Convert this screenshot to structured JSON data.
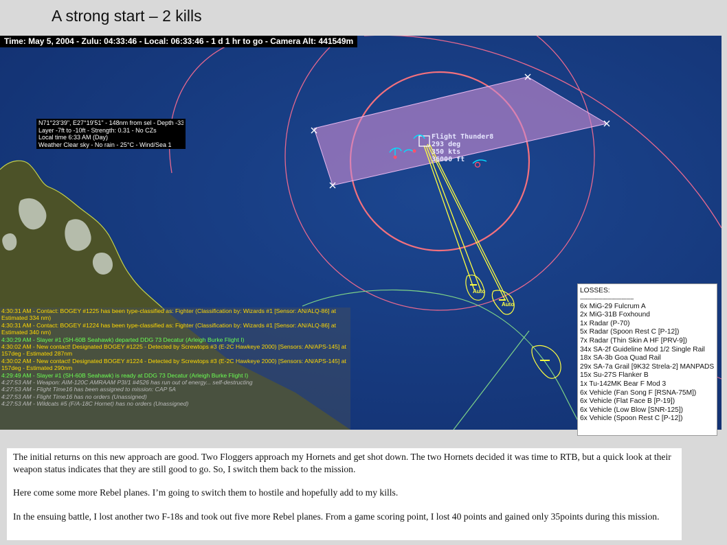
{
  "slide": {
    "title": "A strong start – 2 kills"
  },
  "map": {
    "time_bar": "Time: May 5, 2004 - Zulu: 04:33:46 - Local: 06:33:46 - 1 d 1 hr to go -  Camera Alt: 441549m",
    "info_box": [
      "N71°23'39\", E27°19'51\" - 148nm from sel - Depth -33ft",
      "Layer -7ft to -10ft - Strength: 0.31 - No CZs",
      "Local time 6:33 AM (Day)",
      "Weather Clear sky - No rain - 25°C - Wind/Sea 1"
    ],
    "unit_label": {
      "name": "Flight Thunder8",
      "heading": "293 deg",
      "speed": "350 kts",
      "altitude": "36000 ft"
    },
    "auto_labels": [
      "Auto",
      "Auto"
    ],
    "colors": {
      "ocean": "#14387a",
      "zone": "#e8698f",
      "track": "#ffff40",
      "patrol_area": "#c98ad1"
    }
  },
  "log": [
    {
      "text": "4:30:31 AM - Contact: BOGEY #1225 has been type-classified as: Fighter (Classification by: Wizards #1 [Sensor: AN/ALQ-86] at Estimated 334 nm)",
      "color": "yellow"
    },
    {
      "text": "4:30:31 AM - Contact: BOGEY #1224 has been type-classified as: Fighter (Classification by: Wizards #1 [Sensor: AN/ALQ-86] at Estimated 340 nm)",
      "color": "yellow"
    },
    {
      "text": "4:30:29 AM - Slayer #1 (SH-60B Seahawk) departed DDG 73 Decatur (Arleigh Burke Flight I)",
      "color": "green"
    },
    {
      "text": "4:30:02 AM - New contact! Designated BOGEY #1225 - Detected by Screwtops #3 (E-2C Hawkeye 2000)  [Sensors: AN/APS-145] at 157deg - Estimated 287nm",
      "color": "yellow"
    },
    {
      "text": "4:30:02 AM - New contact! Designated BOGEY #1224 - Detected by Screwtops #3 (E-2C Hawkeye 2000)  [Sensors: AN/APS-145] at 157deg - Estimated 290nm",
      "color": "yellow"
    },
    {
      "text": "4:29:49 AM - Slayer #1 (SH-60B Seahawk) is ready at DDG 73 Decatur (Arleigh Burke Flight I)",
      "color": "green"
    },
    {
      "text": "4:27:53 AM - Weapon: AIM-120C AMRAAM P3I/1 #4526 has run out of energy... self-destructing",
      "color": "gray"
    },
    {
      "text": "4:27:53 AM - Flight Time16 has been assigned to mission: CAP 5A",
      "color": "gray"
    },
    {
      "text": "4:27:53 AM - Flight Time16 has no orders (Unassigned)",
      "color": "gray"
    },
    {
      "text": "4:27:53 AM - Wildcats #5 (F/A-18C Hornet) has no orders (Unassigned)",
      "color": "gray"
    }
  ],
  "losses": {
    "title": "LOSSES:",
    "separator": "------------------------------------",
    "items": [
      "6x MiG-29 Fulcrum A",
      "2x MiG-31B Foxhound",
      "1x Radar (P-70)",
      "5x Radar (Spoon Rest C [P-12])",
      "7x Radar (Thin Skin A HF [PRV-9])",
      "34x SA-2f Guideline Mod 1/2 Single Rail",
      "18x SA-3b Goa Quad Rail",
      "29x SA-7a Grail [9K32 Strela-2] MANPADS",
      "15x Su-27S Flanker B",
      "1x Tu-142MK Bear F Mod 3",
      "6x Vehicle (Fan Song F [RSNA-75M])",
      "6x Vehicle (Flat Face B [P-19])",
      "6x Vehicle (Low Blow [SNR-125])",
      "6x Vehicle (Spoon Rest C [P-12])"
    ]
  },
  "narrative": [
    "The initial returns on this new approach are good.  Two Floggers approach my Hornets and get shot down.  The two Hornets decided it was time to RTB, but a quick look at their weapon status indicates that they are still good to go. So, I switch them back to the mission.",
    "Here come some more Rebel planes.  I’m going to switch them to hostile and hopefully add to my kills.",
    "In the ensuing battle, I lost another two F-18s and took out five more Rebel planes.  From a game scoring point, I lost 40 points and gained only 35points during this mission."
  ]
}
